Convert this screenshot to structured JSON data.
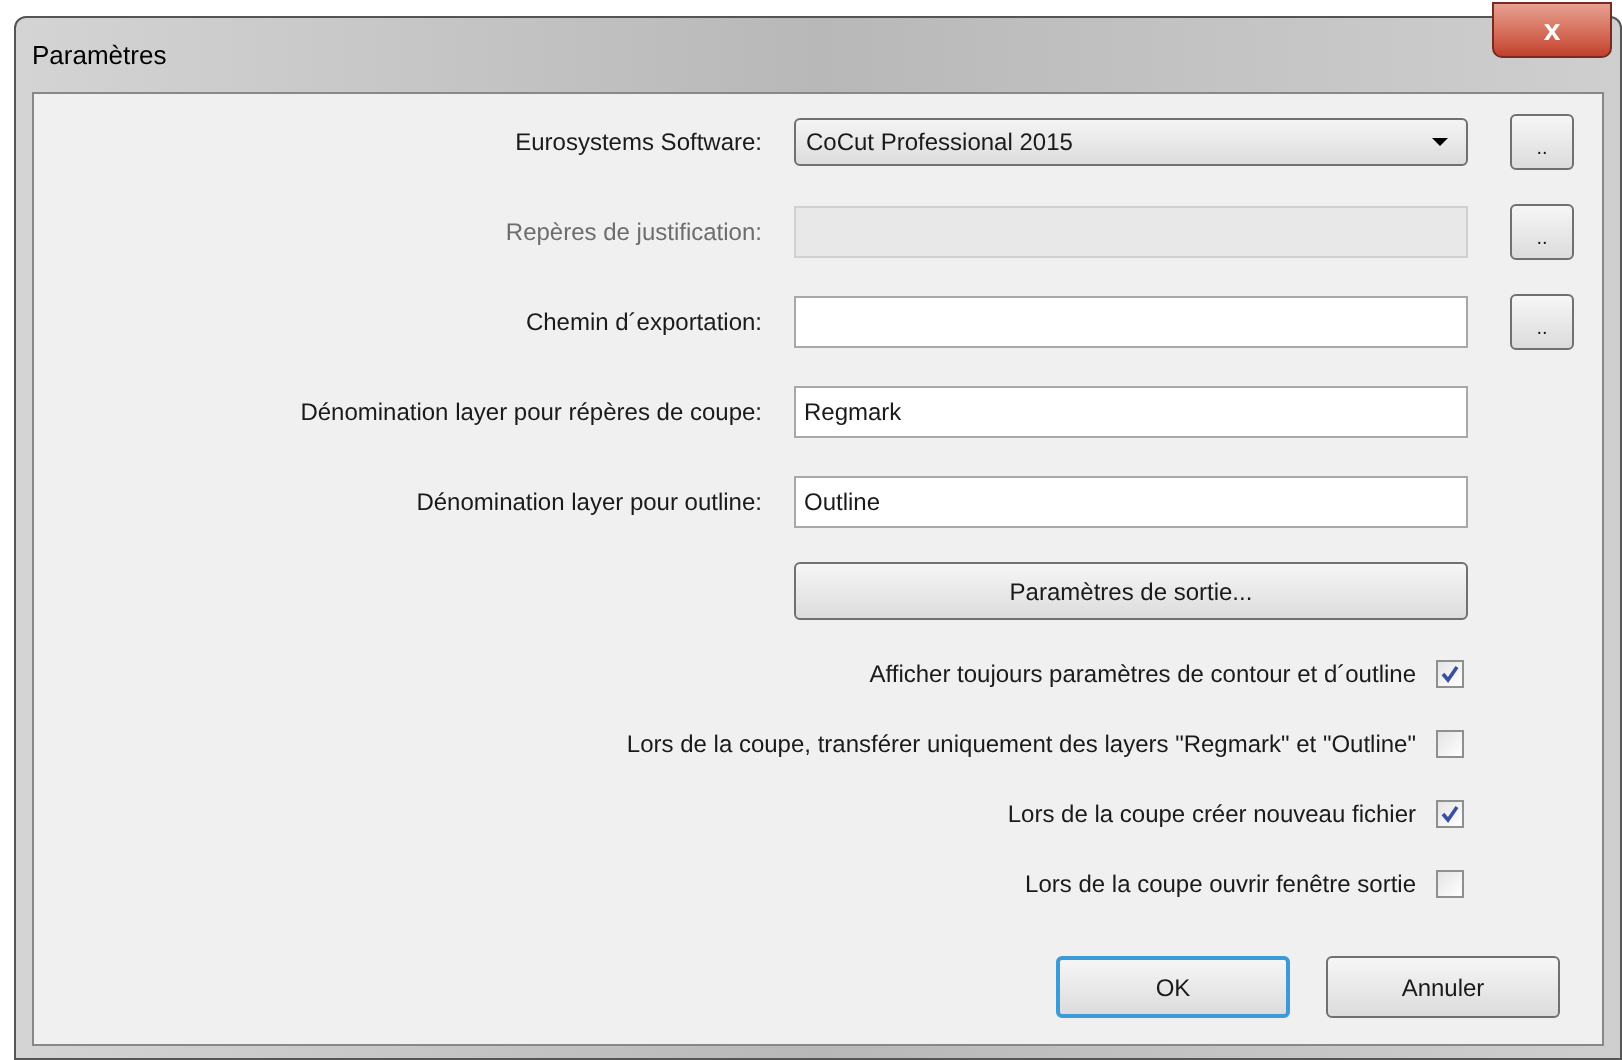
{
  "window": {
    "title": "Paramètres",
    "close": "x"
  },
  "fields": [
    {
      "kind": "combo",
      "label": "Eurosystems Software:",
      "value": "CoCut Professional 2015",
      "disabled": false,
      "browse": ".."
    },
    {
      "kind": "text",
      "label": "Repères de justification:",
      "disabled": true,
      "browse": ".."
    },
    {
      "kind": "text",
      "label": "Chemin d´exportation:",
      "disabled": false,
      "browse": ".."
    },
    {
      "kind": "text",
      "label": "Dénomination layer pour répères de coupe:",
      "value": "Regmark",
      "disabled": false
    },
    {
      "kind": "text",
      "label": "Dénomination layer pour outline:",
      "value": "Outline",
      "disabled": false
    }
  ],
  "output_button": "Paramètres de sortie...",
  "options": [
    {
      "label": "Afficher toujours paramètres de contour et d´outline",
      "checked": true
    },
    {
      "label": "Lors de la coupe, transférer uniquement des layers \"Regmark\" et \"Outline\"",
      "checked": false
    },
    {
      "label": "Lors de la coupe créer nouveau fichier",
      "checked": true
    },
    {
      "label": "Lors de la coupe ouvrir fenêtre sortie",
      "checked": false
    }
  ],
  "buttons": [
    {
      "label": "OK",
      "default": true
    },
    {
      "label": "Annuler",
      "default": false
    }
  ]
}
